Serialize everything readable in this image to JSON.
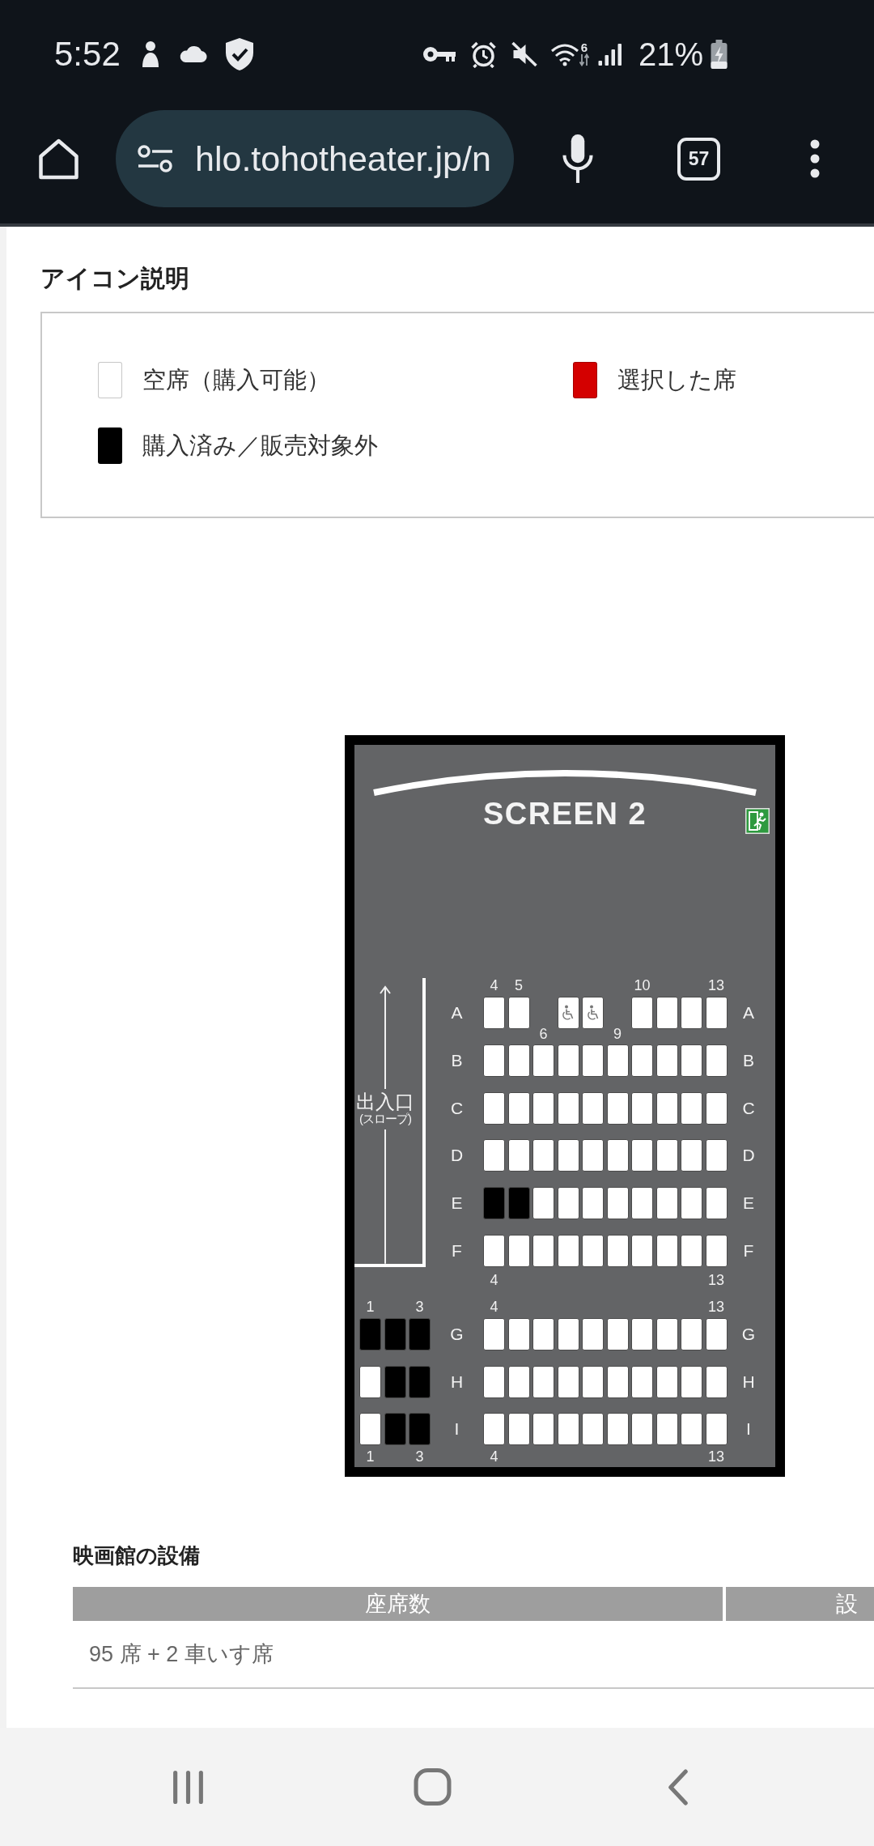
{
  "status_bar": {
    "time": "5:52",
    "wifi_badge": "6",
    "battery": "21%"
  },
  "browser": {
    "url": "hlo.tohotheater.jp/n",
    "tab_count": "57"
  },
  "legend": {
    "title": "アイコン説明",
    "items": [
      {
        "label": "空席（購入可能）",
        "color": "#ffffff"
      },
      {
        "label": "選択した席",
        "color": "#d40000"
      },
      {
        "label": "購入済み／販売対象外",
        "color": "#000000"
      }
    ]
  },
  "seat_map": {
    "screen": "SCREEN 2",
    "sections": [
      {
        "entrance": {
          "label": "出入口",
          "note": "(スロープ)"
        },
        "rows": [
          {
            "label_left": "A",
            "label_right": "A",
            "seats": [
              {
                "kind": "seat",
                "sold": false,
                "selected": false,
                "number_above": "4"
              },
              {
                "kind": "seat",
                "sold": false,
                "selected": false,
                "number_above": "5"
              },
              {
                "kind": "gap",
                "number_below": "6"
              },
              {
                "kind": "wheelchair",
                "sold": false,
                "selected": false
              },
              {
                "kind": "wheelchair",
                "sold": false,
                "selected": false
              },
              {
                "kind": "gap",
                "number_below": "9"
              },
              {
                "kind": "seat",
                "sold": false,
                "selected": false,
                "number_above": "10"
              },
              {
                "kind": "seat",
                "sold": false,
                "selected": false
              },
              {
                "kind": "seat",
                "sold": false,
                "selected": false
              },
              {
                "kind": "seat",
                "sold": false,
                "selected": false,
                "number_above": "13"
              }
            ]
          },
          {
            "label_left": "B",
            "label_right": "B",
            "seats": [
              {
                "kind": "seat",
                "sold": false,
                "selected": false
              },
              {
                "kind": "seat",
                "sold": false,
                "selected": false
              },
              {
                "kind": "seat",
                "sold": false,
                "selected": false
              },
              {
                "kind": "seat",
                "sold": false,
                "selected": false
              },
              {
                "kind": "seat",
                "sold": false,
                "selected": false
              },
              {
                "kind": "seat",
                "sold": false,
                "selected": false
              },
              {
                "kind": "seat",
                "sold": false,
                "selected": false
              },
              {
                "kind": "seat",
                "sold": false,
                "selected": false
              },
              {
                "kind": "seat",
                "sold": false,
                "selected": false
              },
              {
                "kind": "seat",
                "sold": false,
                "selected": false
              }
            ]
          },
          {
            "label_left": "C",
            "label_right": "C",
            "seats": [
              {
                "kind": "seat",
                "sold": false,
                "selected": false
              },
              {
                "kind": "seat",
                "sold": false,
                "selected": false
              },
              {
                "kind": "seat",
                "sold": false,
                "selected": false
              },
              {
                "kind": "seat",
                "sold": false,
                "selected": false
              },
              {
                "kind": "seat",
                "sold": false,
                "selected": false
              },
              {
                "kind": "seat",
                "sold": false,
                "selected": false
              },
              {
                "kind": "seat",
                "sold": false,
                "selected": false
              },
              {
                "kind": "seat",
                "sold": false,
                "selected": false
              },
              {
                "kind": "seat",
                "sold": false,
                "selected": false
              },
              {
                "kind": "seat",
                "sold": false,
                "selected": false
              }
            ]
          },
          {
            "label_left": "D",
            "label_right": "D",
            "seats": [
              {
                "kind": "seat",
                "sold": false,
                "selected": false
              },
              {
                "kind": "seat",
                "sold": false,
                "selected": false
              },
              {
                "kind": "seat",
                "sold": false,
                "selected": false
              },
              {
                "kind": "seat",
                "sold": false,
                "selected": false
              },
              {
                "kind": "seat",
                "sold": false,
                "selected": false
              },
              {
                "kind": "seat",
                "sold": false,
                "selected": false
              },
              {
                "kind": "seat",
                "sold": false,
                "selected": false
              },
              {
                "kind": "seat",
                "sold": false,
                "selected": false
              },
              {
                "kind": "seat",
                "sold": false,
                "selected": false
              },
              {
                "kind": "seat",
                "sold": false,
                "selected": false
              }
            ]
          },
          {
            "label_left": "E",
            "label_right": "E",
            "seats": [
              {
                "kind": "seat",
                "sold": true,
                "selected": false
              },
              {
                "kind": "seat",
                "sold": true,
                "selected": false
              },
              {
                "kind": "seat",
                "sold": false,
                "selected": false
              },
              {
                "kind": "seat",
                "sold": false,
                "selected": false
              },
              {
                "kind": "seat",
                "sold": false,
                "selected": false
              },
              {
                "kind": "seat",
                "sold": false,
                "selected": false
              },
              {
                "kind": "seat",
                "sold": false,
                "selected": false
              },
              {
                "kind": "seat",
                "sold": false,
                "selected": false
              },
              {
                "kind": "seat",
                "sold": false,
                "selected": false
              },
              {
                "kind": "seat",
                "sold": false,
                "selected": false
              }
            ]
          },
          {
            "label_left": "F",
            "label_right": "F",
            "seats": [
              {
                "kind": "seat",
                "sold": false,
                "selected": false,
                "number_below": "4"
              },
              {
                "kind": "seat",
                "sold": false,
                "selected": false
              },
              {
                "kind": "seat",
                "sold": false,
                "selected": false
              },
              {
                "kind": "seat",
                "sold": false,
                "selected": false
              },
              {
                "kind": "seat",
                "sold": false,
                "selected": false
              },
              {
                "kind": "seat",
                "sold": false,
                "selected": false
              },
              {
                "kind": "seat",
                "sold": false,
                "selected": false
              },
              {
                "kind": "seat",
                "sold": false,
                "selected": false
              },
              {
                "kind": "seat",
                "sold": false,
                "selected": false
              },
              {
                "kind": "seat",
                "sold": false,
                "selected": false,
                "number_below": "13"
              }
            ]
          }
        ]
      },
      {
        "rows": [
          {
            "label_left": "G",
            "label_right": "G",
            "left_seats": [
              {
                "kind": "seat",
                "sold": true,
                "selected": false,
                "number_above": "1"
              },
              {
                "kind": "seat",
                "sold": true,
                "selected": false
              },
              {
                "kind": "seat",
                "sold": true,
                "selected": false,
                "number_above": "3"
              }
            ],
            "seats": [
              {
                "kind": "seat",
                "sold": false,
                "selected": false,
                "number_above": "4"
              },
              {
                "kind": "seat",
                "sold": false,
                "selected": false
              },
              {
                "kind": "seat",
                "sold": false,
                "selected": false
              },
              {
                "kind": "seat",
                "sold": false,
                "selected": false
              },
              {
                "kind": "seat",
                "sold": false,
                "selected": false
              },
              {
                "kind": "seat",
                "sold": false,
                "selected": false
              },
              {
                "kind": "seat",
                "sold": false,
                "selected": false
              },
              {
                "kind": "seat",
                "sold": false,
                "selected": false
              },
              {
                "kind": "seat",
                "sold": false,
                "selected": false
              },
              {
                "kind": "seat",
                "sold": false,
                "selected": false,
                "number_above": "13"
              }
            ]
          },
          {
            "label_left": "H",
            "label_right": "H",
            "left_seats": [
              {
                "kind": "seat",
                "sold": false,
                "selected": false
              },
              {
                "kind": "seat",
                "sold": true,
                "selected": false
              },
              {
                "kind": "seat",
                "sold": true,
                "selected": false
              }
            ],
            "seats": [
              {
                "kind": "seat",
                "sold": false,
                "selected": false
              },
              {
                "kind": "seat",
                "sold": false,
                "selected": false
              },
              {
                "kind": "seat",
                "sold": false,
                "selected": false
              },
              {
                "kind": "seat",
                "sold": false,
                "selected": false
              },
              {
                "kind": "seat",
                "sold": false,
                "selected": false
              },
              {
                "kind": "seat",
                "sold": false,
                "selected": false
              },
              {
                "kind": "seat",
                "sold": false,
                "selected": false
              },
              {
                "kind": "seat",
                "sold": false,
                "selected": false
              },
              {
                "kind": "seat",
                "sold": false,
                "selected": false
              },
              {
                "kind": "seat",
                "sold": false,
                "selected": false
              }
            ]
          },
          {
            "label_left": "I",
            "label_right": "I",
            "left_seats": [
              {
                "kind": "seat",
                "sold": false,
                "selected": false,
                "number_below": "1"
              },
              {
                "kind": "seat",
                "sold": true,
                "selected": false
              },
              {
                "kind": "seat",
                "sold": true,
                "selected": false,
                "number_below": "3"
              }
            ],
            "seats": [
              {
                "kind": "seat",
                "sold": false,
                "selected": false,
                "number_below": "4"
              },
              {
                "kind": "seat",
                "sold": false,
                "selected": false
              },
              {
                "kind": "seat",
                "sold": false,
                "selected": false
              },
              {
                "kind": "seat",
                "sold": false,
                "selected": false
              },
              {
                "kind": "seat",
                "sold": false,
                "selected": false
              },
              {
                "kind": "seat",
                "sold": false,
                "selected": false
              },
              {
                "kind": "seat",
                "sold": false,
                "selected": false
              },
              {
                "kind": "seat",
                "sold": false,
                "selected": false
              },
              {
                "kind": "seat",
                "sold": false,
                "selected": false
              },
              {
                "kind": "seat",
                "sold": false,
                "selected": false,
                "number_below": "13"
              }
            ]
          }
        ]
      }
    ]
  },
  "facilities": {
    "title": "映画館の設備",
    "columns": [
      "座席数",
      "設"
    ],
    "rows": [
      [
        "95 席 + 2 車いす席"
      ]
    ]
  }
}
